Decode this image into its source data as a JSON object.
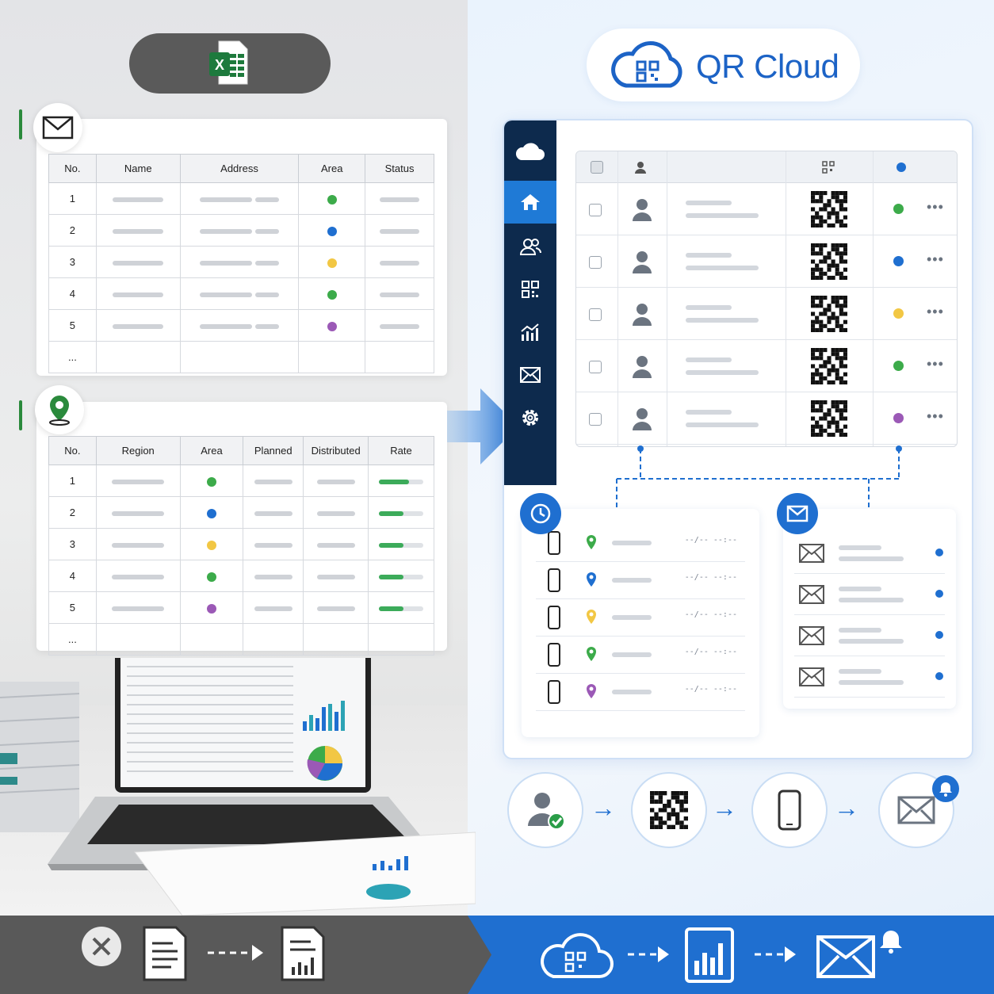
{
  "left": {
    "card1": {
      "columns": [
        "No.",
        "Name",
        "Address",
        "Area",
        "Status"
      ],
      "rows": [
        {
          "no": "1",
          "dot": "#3cab4a"
        },
        {
          "no": "2",
          "dot": "#1f6fd0"
        },
        {
          "no": "3",
          "dot": "#f2c744"
        },
        {
          "no": "4",
          "dot": "#3cab4a"
        },
        {
          "no": "5",
          "dot": "#9b59b6"
        }
      ],
      "ellipsis": "..."
    },
    "card2": {
      "columns": [
        "No.",
        "Region",
        "Area",
        "Planned",
        "Distributed",
        "Rate"
      ],
      "rows": [
        {
          "no": "1",
          "dot": "#3cab4a",
          "rate": 0.68
        },
        {
          "no": "2",
          "dot": "#1f6fd0",
          "rate": 0.55
        },
        {
          "no": "3",
          "dot": "#f2c744",
          "rate": 0.55
        },
        {
          "no": "4",
          "dot": "#3cab4a",
          "rate": 0.55
        },
        {
          "no": "5",
          "dot": "#9b59b6",
          "rate": 0.55
        }
      ],
      "ellipsis": "..."
    }
  },
  "brand": {
    "title": "QR Cloud"
  },
  "app": {
    "sidebar": [
      {
        "icon": "cloud-icon",
        "active": false
      },
      {
        "icon": "home-icon",
        "active": true
      },
      {
        "icon": "users-icon",
        "active": false
      },
      {
        "icon": "qr-code-icon",
        "active": false
      },
      {
        "icon": "analytics-icon",
        "active": false
      },
      {
        "icon": "mail-icon",
        "active": false
      },
      {
        "icon": "settings-icon",
        "active": false
      }
    ],
    "grid_status": [
      "#3cab4a",
      "#1f6fd0",
      "#f2c744",
      "#3cab4a",
      "#9b59b6"
    ],
    "more_label": "•••",
    "log_rows": [
      {
        "pin": "#3cab4a",
        "time": "--/--  --:--"
      },
      {
        "pin": "#1f6fd0",
        "time": "--/--  --:--"
      },
      {
        "pin": "#f2c744",
        "time": "--/--  --:--"
      },
      {
        "pin": "#3cab4a",
        "time": "--/--  --:--"
      },
      {
        "pin": "#9b59b6",
        "time": "--/--  --:--"
      }
    ]
  },
  "colors": {
    "accent": "#1f6fd0",
    "sidebar": "#0d2a4d",
    "green": "#2a8a3c"
  }
}
